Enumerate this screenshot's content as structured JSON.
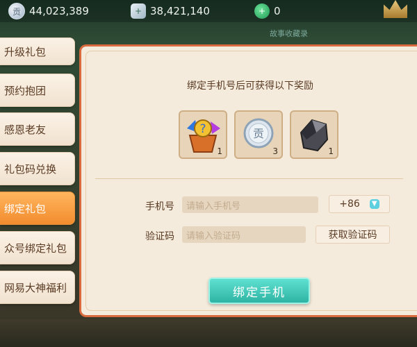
{
  "currencies": [
    {
      "icon": "silver-coin-icon",
      "glyph": "贡",
      "value": "44,023,389"
    },
    {
      "icon": "silver-ingot-icon",
      "glyph": "+",
      "value": "38,421,140"
    },
    {
      "icon": "jade-icon",
      "glyph": "+",
      "value": "0"
    }
  ],
  "top_watermark": "故事收藏录",
  "nav": {
    "items": [
      {
        "label": "升级礼包"
      },
      {
        "label": "预约抱团"
      },
      {
        "label": "感恩老友"
      },
      {
        "label": "礼包码兑换"
      },
      {
        "label": "绑定礼包",
        "active": true
      },
      {
        "label": "众号绑定礼包"
      },
      {
        "label": "网易大神福利"
      }
    ]
  },
  "rewards": {
    "title": "绑定手机号后可获得以下奖励",
    "items": [
      {
        "icon": "gem-bag-icon",
        "count": "1"
      },
      {
        "icon": "silver-coin-icon",
        "glyph": "贡",
        "count": "3"
      },
      {
        "icon": "ore-stone-icon",
        "count": "1"
      }
    ]
  },
  "form": {
    "phone_label": "手机号",
    "phone_placeholder": "请输入手机号",
    "country_code": "+86",
    "code_label": "验证码",
    "code_placeholder": "请输入验证码",
    "get_code_label": "获取验证码",
    "submit_label": "绑定手机"
  },
  "colors": {
    "accent": "#f28c2e",
    "button": "#2eb4a4",
    "panel_border": "#d86a3e"
  }
}
